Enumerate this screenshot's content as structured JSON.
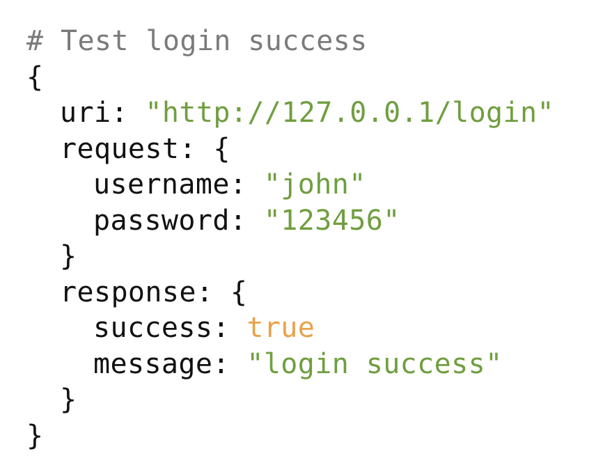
{
  "colors": {
    "background": "#ffffff",
    "text": "#111111",
    "comment": "#7a7a7a",
    "string": "#6f9e3f",
    "boolean": "#e8a24a"
  },
  "code": {
    "comment": "# Test login success",
    "open_brace": "{",
    "uri_key": "uri:",
    "uri_value": "\"http://127.0.0.1/login\"",
    "request_key": "request:",
    "request_open": "{",
    "username_key": "username:",
    "username_value": "\"john\"",
    "password_key": "password:",
    "password_value": "\"123456\"",
    "request_close": "}",
    "response_key": "response:",
    "response_open": "{",
    "success_key": "success:",
    "success_value": "true",
    "message_key": "message:",
    "message_value": "\"login success\"",
    "response_close": "}",
    "close_brace": "}"
  }
}
